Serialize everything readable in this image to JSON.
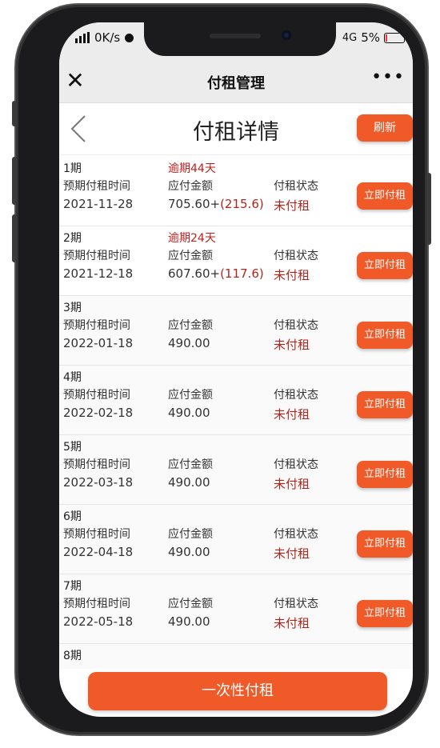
{
  "status_bar": {
    "speed": "0K/s",
    "network": "4G",
    "battery": "5%"
  },
  "nav": {
    "title": "付租管理",
    "close_icon": "close-icon",
    "more_icon": "more-icon"
  },
  "page": {
    "title": "付租详情",
    "refresh_label": "刷新"
  },
  "columns": {
    "date_label": "预期付租时间",
    "amount_label": "应付金额",
    "status_label": "付租状态"
  },
  "pay_button_label": "立即付租",
  "installments": [
    {
      "period": "1期",
      "overdue": "逾期44天",
      "date": "2021-11-28",
      "amount": "705.60+",
      "extra": "(215.6)",
      "status": "未付租"
    },
    {
      "period": "2期",
      "overdue": "逾期24天",
      "date": "2021-12-18",
      "amount": "607.60+",
      "extra": "(117.6)",
      "status": "未付租"
    },
    {
      "period": "3期",
      "overdue": "",
      "date": "2022-01-18",
      "amount": "490.00",
      "extra": "",
      "status": "未付租"
    },
    {
      "period": "4期",
      "overdue": "",
      "date": "2022-02-18",
      "amount": "490.00",
      "extra": "",
      "status": "未付租"
    },
    {
      "period": "5期",
      "overdue": "",
      "date": "2022-03-18",
      "amount": "490.00",
      "extra": "",
      "status": "未付租"
    },
    {
      "period": "6期",
      "overdue": "",
      "date": "2022-04-18",
      "amount": "490.00",
      "extra": "",
      "status": "未付租"
    },
    {
      "period": "7期",
      "overdue": "",
      "date": "2022-05-18",
      "amount": "490.00",
      "extra": "",
      "status": "未付租"
    },
    {
      "period": "8期"
    }
  ],
  "bottom_button_label": "一次性付租",
  "colors": {
    "accent": "#f05a28",
    "overdue": "#c21f1f"
  }
}
